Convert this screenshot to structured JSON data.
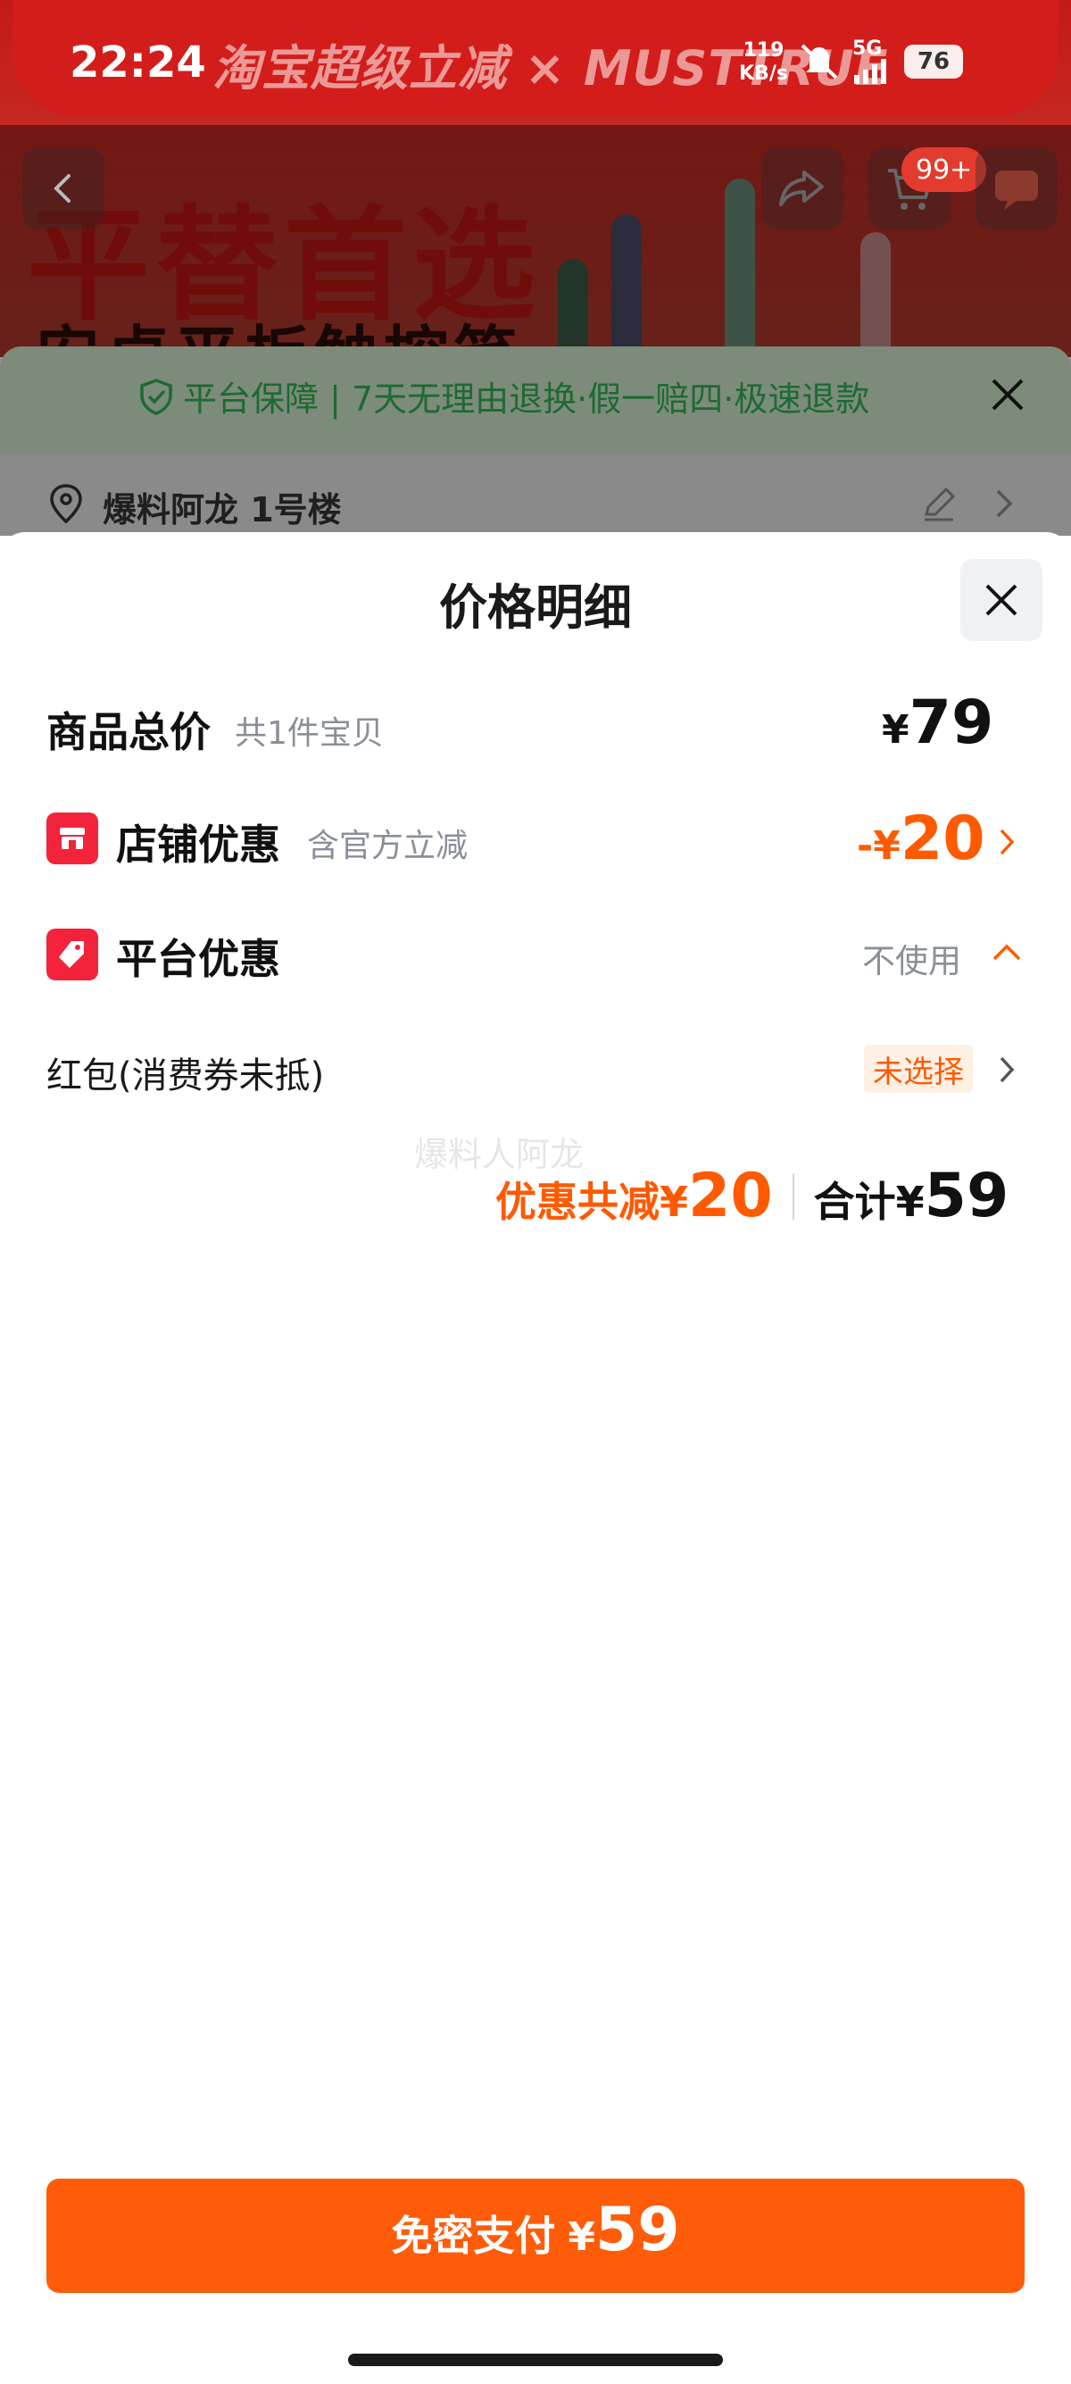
{
  "status_bar": {
    "time": "22:24",
    "net_speed_value": "119",
    "net_speed_unit": "KB/s",
    "network": "5G",
    "battery": "76"
  },
  "background": {
    "banner_brand": "淘宝超级立减 × MUSTTRUE",
    "promo_title": "平替首选",
    "promo_subtitle": "安卓平板触控笔",
    "cart_badge": "99+",
    "service_guarantee": "平台保障 | 7天无理由退换·假一赔四·极速退款",
    "address": "爆料阿龙 1号楼"
  },
  "sheet": {
    "title": "价格明细",
    "rows": {
      "goods_total": {
        "label": "商品总价",
        "sub": "共1件宝贝",
        "currency": "¥",
        "amount": "79"
      },
      "shop_discount": {
        "label": "店铺优惠",
        "sub": "含官方立减",
        "prefix": "-",
        "currency": "¥",
        "amount": "20"
      },
      "platform_discount": {
        "label": "平台优惠",
        "value": "不使用"
      },
      "red_packet": {
        "label": "红包(消费券未抵)",
        "value": "未选择"
      }
    },
    "watermark": "爆料人阿龙",
    "summary": {
      "discount_label": "优惠共减",
      "discount_currency": "¥",
      "discount_amount": "20",
      "total_label": "合计",
      "total_currency": "¥",
      "total_amount": "59"
    },
    "pay_button": {
      "label": "免密支付",
      "currency": "¥",
      "amount": "59"
    }
  },
  "colors": {
    "accent_orange": "#ff5a00",
    "icon_red": "#f2233b",
    "pay_button": "#ff5c0a",
    "guarantee_green": "#1c6b32"
  }
}
